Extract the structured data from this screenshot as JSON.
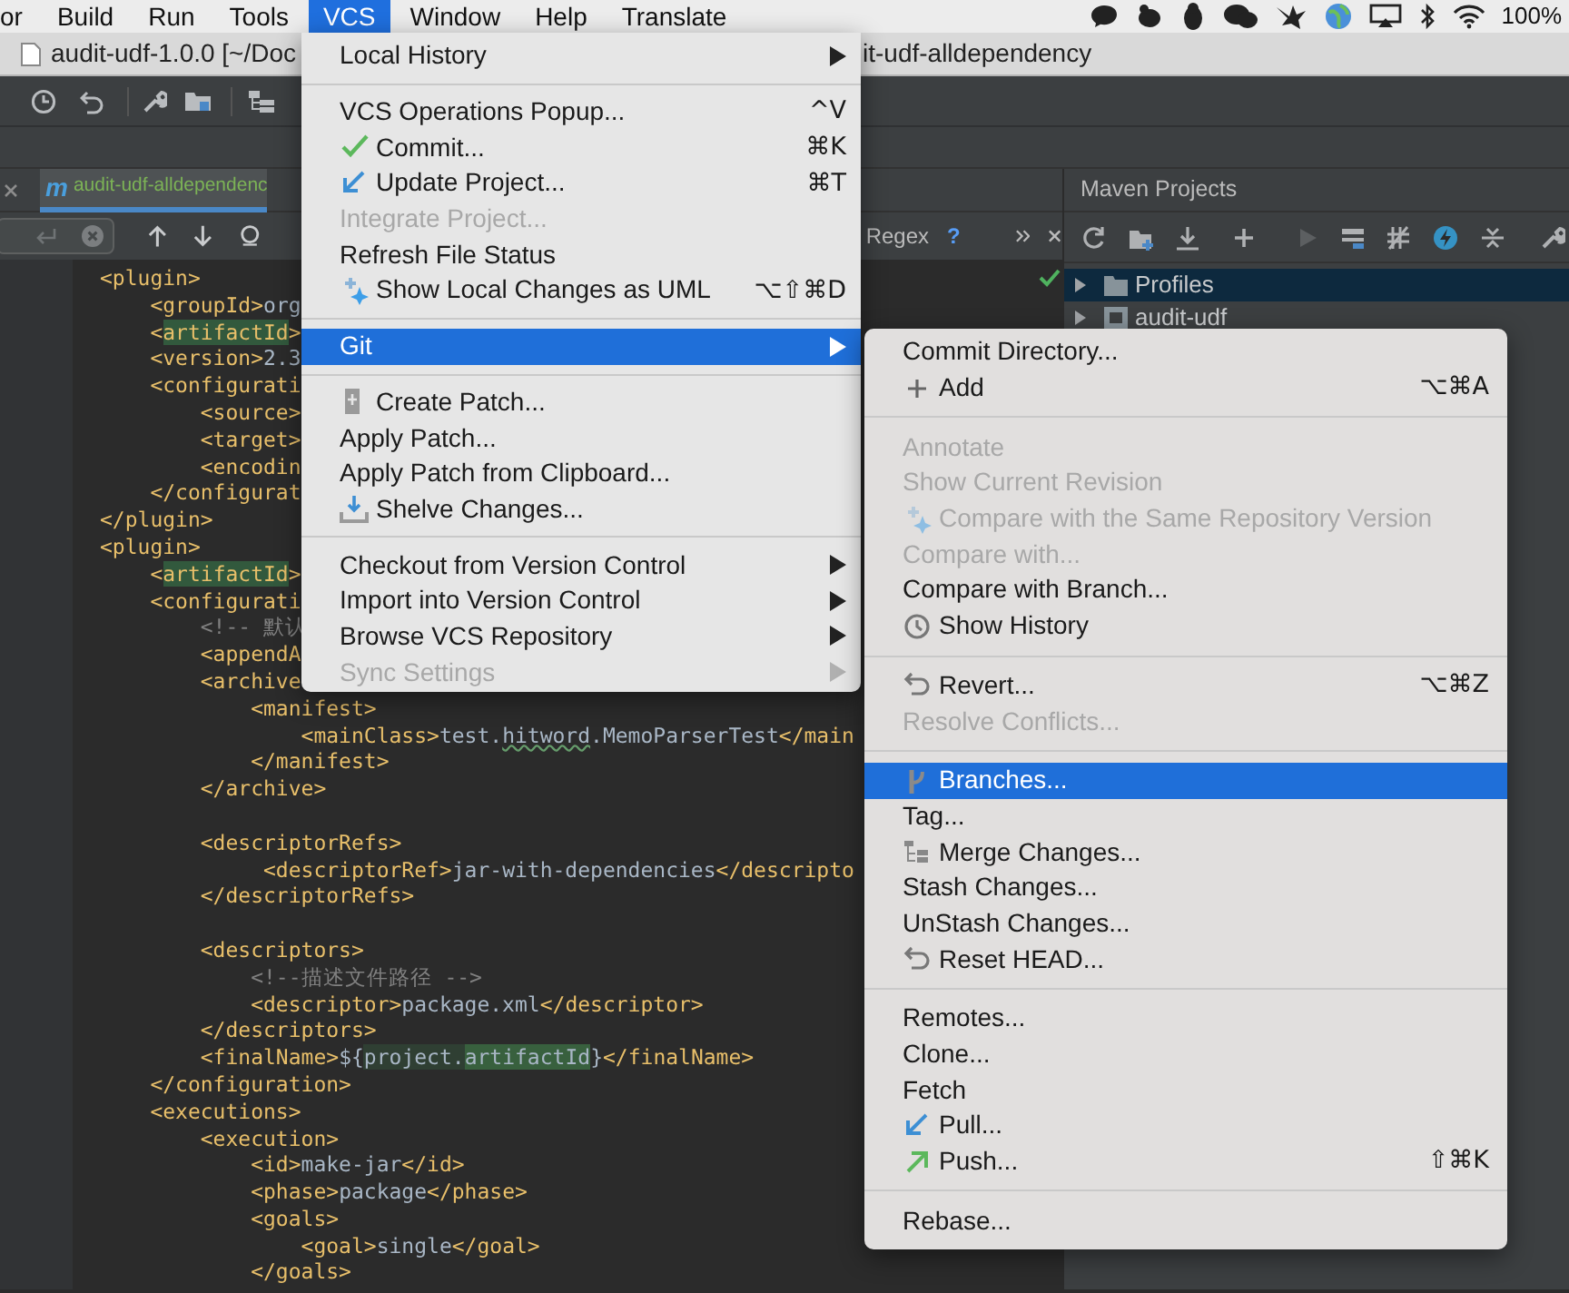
{
  "menubar": {
    "items": [
      {
        "label": "or",
        "selected": false
      },
      {
        "label": "Build",
        "selected": false
      },
      {
        "label": "Run",
        "selected": false
      },
      {
        "label": "Tools",
        "selected": false
      },
      {
        "label": "VCS",
        "selected": true
      },
      {
        "label": "Window",
        "selected": false
      },
      {
        "label": "Help",
        "selected": false
      },
      {
        "label": "Translate",
        "selected": false
      }
    ],
    "battery_text": "100%"
  },
  "title_bar": {
    "left": "audit-udf-1.0.0 [~/Doc",
    "right": "it-udf-alldependency"
  },
  "editor_tab": {
    "icon_glyph": "m",
    "label": "audit-udf-alldependenc"
  },
  "find_bar": {
    "regex_label": "Regex",
    "help": "?"
  },
  "code_lines": [
    {
      "kind": "code",
      "segments": [
        {
          "kind": "tag",
          "text": "<plugin>"
        }
      ]
    },
    {
      "kind": "code",
      "segments": [
        {
          "kind": "tag",
          "text": "    <groupId>"
        },
        {
          "kind": "text",
          "text": "org"
        }
      ]
    },
    {
      "kind": "code",
      "segments": [
        {
          "kind": "tag",
          "text": "    <"
        },
        {
          "kind": "match",
          "text": "artifactId"
        },
        {
          "kind": "tag",
          "text": ">"
        }
      ]
    },
    {
      "kind": "code",
      "segments": [
        {
          "kind": "tag",
          "text": "    <version>"
        },
        {
          "kind": "text",
          "text": "2.3"
        }
      ]
    },
    {
      "kind": "code",
      "segments": [
        {
          "kind": "tag",
          "text": "    <configurati"
        }
      ]
    },
    {
      "kind": "code",
      "segments": [
        {
          "kind": "tag",
          "text": "        <source>"
        }
      ]
    },
    {
      "kind": "code",
      "segments": [
        {
          "kind": "tag",
          "text": "        <target>"
        }
      ]
    },
    {
      "kind": "code",
      "segments": [
        {
          "kind": "tag",
          "text": "        <encodin"
        }
      ]
    },
    {
      "kind": "code",
      "segments": [
        {
          "kind": "tag",
          "text": "    </configurat"
        }
      ]
    },
    {
      "kind": "code",
      "segments": [
        {
          "kind": "tag",
          "text": "</plugin>"
        }
      ]
    },
    {
      "kind": "code",
      "segments": [
        {
          "kind": "tag",
          "text": "<plugin>"
        }
      ]
    },
    {
      "kind": "code",
      "segments": [
        {
          "kind": "tag",
          "text": "    <"
        },
        {
          "kind": "match",
          "text": "artifactId"
        },
        {
          "kind": "tag",
          "text": ">"
        }
      ]
    },
    {
      "kind": "code",
      "segments": [
        {
          "kind": "tag",
          "text": "    <configurati"
        }
      ]
    },
    {
      "kind": "code",
      "segments": [
        {
          "kind": "comment",
          "text": "        <!-- 默认"
        }
      ]
    },
    {
      "kind": "code",
      "segments": [
        {
          "kind": "tag",
          "text": "        <appendA"
        }
      ]
    },
    {
      "kind": "code",
      "segments": [
        {
          "kind": "tag",
          "text": "        <archive"
        }
      ]
    },
    {
      "kind": "code",
      "segments": [
        {
          "kind": "tag",
          "text": "            <manifest>"
        }
      ]
    },
    {
      "kind": "code",
      "segments": [
        {
          "kind": "tag",
          "text": "                <mainClass>"
        },
        {
          "kind": "text",
          "text": "test."
        },
        {
          "kind": "typo",
          "text": "hitword"
        },
        {
          "kind": "text",
          "text": ".MemoParserTest"
        },
        {
          "kind": "tag",
          "text": "</main"
        }
      ]
    },
    {
      "kind": "code",
      "segments": [
        {
          "kind": "tag",
          "text": "            </manifest>"
        }
      ]
    },
    {
      "kind": "code",
      "segments": [
        {
          "kind": "tag",
          "text": "        </archive>"
        }
      ]
    },
    {
      "kind": "blank"
    },
    {
      "kind": "code",
      "segments": [
        {
          "kind": "tag",
          "text": "        <descriptorRefs>"
        }
      ]
    },
    {
      "kind": "code",
      "segments": [
        {
          "kind": "tag",
          "text": "             <descriptorRef>"
        },
        {
          "kind": "text",
          "text": "jar-with-dependencies"
        },
        {
          "kind": "tag",
          "text": "</descripto"
        }
      ]
    },
    {
      "kind": "code",
      "segments": [
        {
          "kind": "tag",
          "text": "        </descriptorRefs>"
        }
      ]
    },
    {
      "kind": "blank"
    },
    {
      "kind": "code",
      "segments": [
        {
          "kind": "tag",
          "text": "        <descriptors>"
        }
      ]
    },
    {
      "kind": "code",
      "segments": [
        {
          "kind": "comment",
          "text": "            <!--描述文件路径 -->"
        }
      ]
    },
    {
      "kind": "code",
      "segments": [
        {
          "kind": "tag",
          "text": "            <descriptor>"
        },
        {
          "kind": "text",
          "text": "package.xml"
        },
        {
          "kind": "tag",
          "text": "</descriptor>"
        }
      ]
    },
    {
      "kind": "code",
      "segments": [
        {
          "kind": "tag",
          "text": "        </descriptors>"
        }
      ]
    },
    {
      "kind": "code",
      "segments": [
        {
          "kind": "tag",
          "text": "        <finalName>"
        },
        {
          "kind": "text",
          "text": "${"
        },
        {
          "kind": "match_text",
          "text": "project."
        },
        {
          "kind": "match_text_strong",
          "text": "artifactId"
        },
        {
          "kind": "text",
          "text": "}"
        },
        {
          "kind": "tag",
          "text": "</finalName>"
        }
      ]
    },
    {
      "kind": "code",
      "segments": [
        {
          "kind": "tag",
          "text": "    </configuration>"
        }
      ]
    },
    {
      "kind": "code",
      "segments": [
        {
          "kind": "tag",
          "text": "    <executions>"
        }
      ]
    },
    {
      "kind": "code",
      "segments": [
        {
          "kind": "tag",
          "text": "        <execution>"
        }
      ]
    },
    {
      "kind": "code",
      "segments": [
        {
          "kind": "tag",
          "text": "            <id>"
        },
        {
          "kind": "text",
          "text": "make-jar"
        },
        {
          "kind": "tag",
          "text": "</id>"
        }
      ]
    },
    {
      "kind": "code",
      "segments": [
        {
          "kind": "tag",
          "text": "            <phase>"
        },
        {
          "kind": "text",
          "text": "package"
        },
        {
          "kind": "tag",
          "text": "</phase>"
        }
      ]
    },
    {
      "kind": "code",
      "segments": [
        {
          "kind": "tag",
          "text": "            <goals>"
        }
      ]
    },
    {
      "kind": "code",
      "segments": [
        {
          "kind": "tag",
          "text": "                <goal>"
        },
        {
          "kind": "text",
          "text": "single"
        },
        {
          "kind": "tag",
          "text": "</goal>"
        }
      ]
    },
    {
      "kind": "code",
      "segments": [
        {
          "kind": "tag",
          "text": "            </goals>"
        }
      ]
    }
  ],
  "maven": {
    "title": "Maven Projects",
    "tree": [
      {
        "kind": "folder",
        "label": "Profiles",
        "selected": true,
        "expanded": false
      },
      {
        "kind": "module",
        "label": "audit-udf",
        "selected": false,
        "expanded": false
      }
    ]
  },
  "vcs_menu": {
    "items": [
      {
        "kind": "item",
        "label": "Local History",
        "disabled": false,
        "selected": false,
        "submenu": true
      },
      {
        "kind": "separator"
      },
      {
        "kind": "item",
        "label": "VCS Operations Popup...",
        "shortcut": "^V",
        "disabled": false,
        "selected": false,
        "submenu": false
      },
      {
        "kind": "item",
        "label": "Commit...",
        "shortcut": "⌘K",
        "disabled": false,
        "selected": false,
        "submenu": false
      },
      {
        "kind": "item",
        "label": "Update Project...",
        "shortcut": "⌘T",
        "disabled": false,
        "selected": false,
        "submenu": false
      },
      {
        "kind": "item",
        "label": "Integrate Project...",
        "disabled": true,
        "selected": false,
        "submenu": false
      },
      {
        "kind": "item",
        "label": "Refresh File Status",
        "disabled": false,
        "selected": false,
        "submenu": false
      },
      {
        "kind": "item",
        "label": "Show Local Changes as UML",
        "shortcut": "⌥⇧⌘D",
        "disabled": false,
        "selected": false,
        "submenu": false
      },
      {
        "kind": "separator"
      },
      {
        "kind": "item",
        "label": "Git",
        "disabled": false,
        "selected": true,
        "submenu": true
      },
      {
        "kind": "separator"
      },
      {
        "kind": "item",
        "label": "Create Patch...",
        "disabled": false,
        "selected": false,
        "submenu": false
      },
      {
        "kind": "item",
        "label": "Apply Patch...",
        "disabled": false,
        "selected": false,
        "submenu": false
      },
      {
        "kind": "item",
        "label": "Apply Patch from Clipboard...",
        "disabled": false,
        "selected": false,
        "submenu": false
      },
      {
        "kind": "item",
        "label": "Shelve Changes...",
        "disabled": false,
        "selected": false,
        "submenu": false
      },
      {
        "kind": "separator"
      },
      {
        "kind": "item",
        "label": "Checkout from Version Control",
        "disabled": false,
        "selected": false,
        "submenu": true
      },
      {
        "kind": "item",
        "label": "Import into Version Control",
        "disabled": false,
        "selected": false,
        "submenu": true
      },
      {
        "kind": "item",
        "label": "Browse VCS Repository",
        "disabled": false,
        "selected": false,
        "submenu": true
      },
      {
        "kind": "item",
        "label": "Sync Settings",
        "disabled": true,
        "selected": false,
        "submenu": true
      }
    ]
  },
  "git_menu": {
    "items": [
      {
        "kind": "item",
        "label": "Commit Directory...",
        "disabled": false,
        "selected": false
      },
      {
        "kind": "item",
        "label": "Add",
        "shortcut": "⌥⌘A",
        "disabled": false,
        "selected": false
      },
      {
        "kind": "separator"
      },
      {
        "kind": "item",
        "label": "Annotate",
        "disabled": true,
        "selected": false
      },
      {
        "kind": "item",
        "label": "Show Current Revision",
        "disabled": true,
        "selected": false
      },
      {
        "kind": "item",
        "label": "Compare with the Same Repository Version",
        "disabled": true,
        "selected": false
      },
      {
        "kind": "item",
        "label": "Compare with...",
        "disabled": true,
        "selected": false
      },
      {
        "kind": "item",
        "label": "Compare with Branch...",
        "disabled": false,
        "selected": false
      },
      {
        "kind": "item",
        "label": "Show History",
        "disabled": false,
        "selected": false
      },
      {
        "kind": "separator"
      },
      {
        "kind": "item",
        "label": "Revert...",
        "shortcut": "⌥⌘Z",
        "disabled": false,
        "selected": false
      },
      {
        "kind": "item",
        "label": "Resolve Conflicts...",
        "disabled": true,
        "selected": false
      },
      {
        "kind": "separator"
      },
      {
        "kind": "item",
        "label": "Branches...",
        "disabled": false,
        "selected": true
      },
      {
        "kind": "item",
        "label": "Tag...",
        "disabled": false,
        "selected": false
      },
      {
        "kind": "item",
        "label": "Merge Changes...",
        "disabled": false,
        "selected": false
      },
      {
        "kind": "item",
        "label": "Stash Changes...",
        "disabled": false,
        "selected": false
      },
      {
        "kind": "item",
        "label": "UnStash Changes...",
        "disabled": false,
        "selected": false
      },
      {
        "kind": "item",
        "label": "Reset HEAD...",
        "disabled": false,
        "selected": false
      },
      {
        "kind": "separator"
      },
      {
        "kind": "item",
        "label": "Remotes...",
        "disabled": false,
        "selected": false
      },
      {
        "kind": "item",
        "label": "Clone...",
        "disabled": false,
        "selected": false
      },
      {
        "kind": "item",
        "label": "Fetch",
        "disabled": false,
        "selected": false
      },
      {
        "kind": "item",
        "label": "Pull...",
        "disabled": false,
        "selected": false
      },
      {
        "kind": "item",
        "label": "Push...",
        "shortcut": "⇧⌘K",
        "disabled": false,
        "selected": false
      },
      {
        "kind": "separator"
      },
      {
        "kind": "item",
        "label": "Rebase...",
        "disabled": false,
        "selected": false
      }
    ]
  }
}
